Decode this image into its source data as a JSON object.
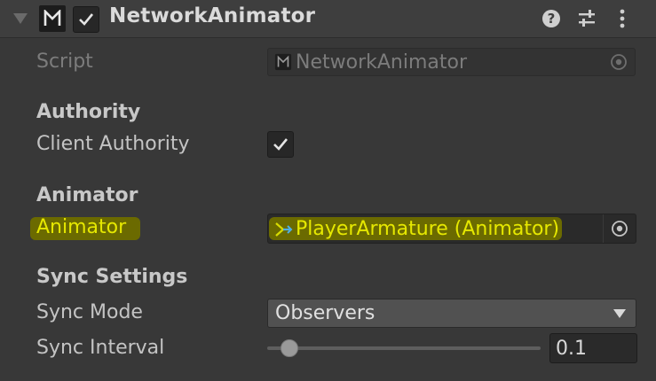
{
  "header": {
    "component_name": "NetworkAnimator",
    "enabled": true,
    "icons": {
      "foldout": "triangle-down-icon",
      "component": "mirror-script-icon",
      "help": "help-icon",
      "presets": "sliders-icon",
      "menu": "kebab-menu-icon"
    }
  },
  "script": {
    "label": "Script",
    "value": "NetworkAnimator"
  },
  "authority": {
    "heading": "Authority",
    "client_authority_label": "Client Authority",
    "client_authority_checked": true
  },
  "animator_section": {
    "heading": "Animator",
    "animator_label": "Animator",
    "animator_value": "PlayerArmature (Animator)"
  },
  "sync": {
    "heading": "Sync Settings",
    "mode_label": "Sync Mode",
    "mode_value": "Observers",
    "interval_label": "Sync Interval",
    "interval_value": "0.1",
    "interval_slider_fraction": 0.08
  },
  "colors": {
    "background": "#383838",
    "highlight_text": "#e6e800",
    "highlight_marker": "#6b6a00"
  }
}
